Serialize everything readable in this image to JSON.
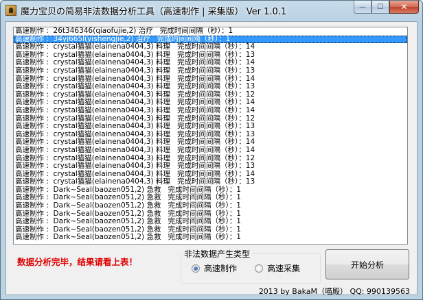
{
  "window": {
    "title": "魔力宝贝の简易非法数据分析工具（高速制作 | 采集版） Ver 1.0.1",
    "minimize_glyph": "—",
    "maximize_glyph": "☐",
    "close_glyph": "✕"
  },
  "log": {
    "selected_index": 1,
    "rows": [
      "高速制作 :  26t346346(qiaofujie,2) 治疗   完成时间间隔（秒）：1",
      "高速制作 :  34yj665l(yishengjie,2) 治疗   完成时间间隔（秒）：1",
      "高速制作 :  crystal猫猫(elainena0404,3) 料理   完成时间间隔（秒）：14",
      "高速制作 :  crystal猫猫(elainena0404,3) 料理   完成时间间隔（秒）：13",
      "高速制作 :  crystal猫猫(elainena0404,3) 料理   完成时间间隔（秒）：14",
      "高速制作 :  crystal猫猫(elainena0404,3) 料理   完成时间间隔（秒）：13",
      "高速制作 :  crystal猫猫(elainena0404,3) 料理   完成时间间隔（秒）：14",
      "高速制作 :  crystal猫猫(elainena0404,3) 料理   完成时间间隔（秒）：13",
      "高速制作 :  crystal猫猫(elainena0404,3) 料理   完成时间间隔（秒）：12",
      "高速制作 :  crystal猫猫(elainena0404,3) 料理   完成时间间隔（秒）：14",
      "高速制作 :  crystal猫猫(elainena0404,3) 料理   完成时间间隔（秒）：14",
      "高速制作 :  crystal猫猫(elainena0404,3) 料理   完成时间间隔（秒）：12",
      "高速制作 :  crystal猫猫(elainena0404,3) 料理   完成时间间隔（秒）：13",
      "高速制作 :  crystal猫猫(elainena0404,3) 料理   完成时间间隔（秒）：13",
      "高速制作 :  crystal猫猫(elainena0404,3) 料理   完成时间间隔（秒）：14",
      "高速制作 :  crystal猫猫(elainena0404,3) 料理   完成时间间隔（秒）：14",
      "高速制作 :  crystal猫猫(elainena0404,3) 料理   完成时间间隔（秒）：12",
      "高速制作 :  crystal猫猫(elainena0404,3) 料理   完成时间间隔（秒）：13",
      "高速制作 :  crystal猫猫(elainena0404,3) 料理   完成时间间隔（秒）：14",
      "高速制作 :  crystal猫猫(elainena0404,3) 料理   完成时间间隔（秒）：13",
      "高速制作 :  Dark~Seal(baozen051,2) 急救   完成时间间隔（秒）：1",
      "高速制作 :  Dark~Seal(baozen051,2) 急救   完成时间间隔（秒）：1",
      "高速制作 :  Dark~Seal(baozen051,2) 急救   完成时间间隔（秒）：1",
      "高速制作 :  Dark~Seal(baozen051,2) 急救   完成时间间隔（秒）：1",
      "高速制作 :  Dark~Seal(baozen051,2) 急救   完成时间间隔（秒）：1",
      "高速制作 :  Dark~Seal(baozen051,2) 急救   完成时间间隔（秒）：1",
      "高速制作 :  Dark~Seal(baozen051,2) 急救   完成时间间隔（秒）：1"
    ]
  },
  "status": {
    "message": "数据分析完毕，结果请看上表！",
    "color": "#e00000"
  },
  "type_group": {
    "title": "非法数据产生类型",
    "options": [
      {
        "label": "高速制作",
        "checked": true
      },
      {
        "label": "高速采集",
        "checked": false
      }
    ]
  },
  "actions": {
    "start_label": "开始分析"
  },
  "footer": {
    "credit": "2013 by BakaM（喵殿） QQ: 990139563"
  }
}
